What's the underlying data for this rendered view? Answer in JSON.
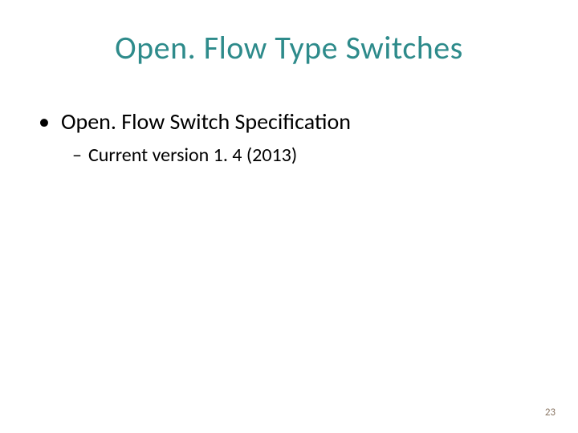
{
  "title": "Open. Flow Type Switches",
  "bullet": {
    "marker": "•",
    "text": "Open. Flow Switch Specification"
  },
  "sub": {
    "marker": "–",
    "text": "Current version 1. 4 (2013)"
  },
  "page_number": "23"
}
